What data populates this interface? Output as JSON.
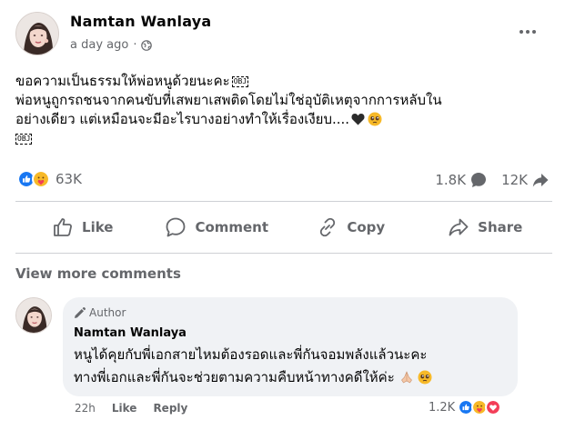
{
  "post": {
    "author": "Namtan Wanlaya",
    "time": "a day ago",
    "privacy_icon": "globe-icon",
    "more_icon": "ellipsis-icon",
    "text_lines": [
      "ขอความเป็นธรรมให้พ่อหนูด้วยนะคะ",
      "พ่อหนูถูกรถชนจากคนขับที่เสพยาเสพติดโดยไม่ใช่อุบัติเหตุจากการหลับใน",
      "อย่างเดียว แต่เหมือนจะมีอะไรบางอย่างทำให้เรื่องเงียบ...."
    ],
    "obj_badge": "OBJ",
    "reaction_count": "63K",
    "comment_count": "1.8K",
    "share_count": "12K",
    "actions": {
      "like": "Like",
      "comment": "Comment",
      "copy": "Copy",
      "share": "Share"
    }
  },
  "comments": {
    "view_more": "View more comments",
    "items": [
      {
        "badge": "Author",
        "author": "Namtan Wanlaya",
        "lines": [
          "หนูได้คุยกับพี่เอกสายไหมต้องรอดและพี่กันจอมพลังแล้วนะคะ",
          "ทางพี่เอกและพี่กันจะช่วยตามความคืบหน้าทางคดีให้ค่ะ"
        ],
        "time": "22h",
        "like": "Like",
        "reply": "Reply",
        "reaction_count": "1.2K"
      }
    ]
  },
  "colors": {
    "text": "#050505",
    "muted": "#65676b",
    "like_blue": "#1877f2",
    "care_yellow": "#f7b928",
    "love_red": "#f33e58",
    "bubble": "#f0f2f5"
  }
}
